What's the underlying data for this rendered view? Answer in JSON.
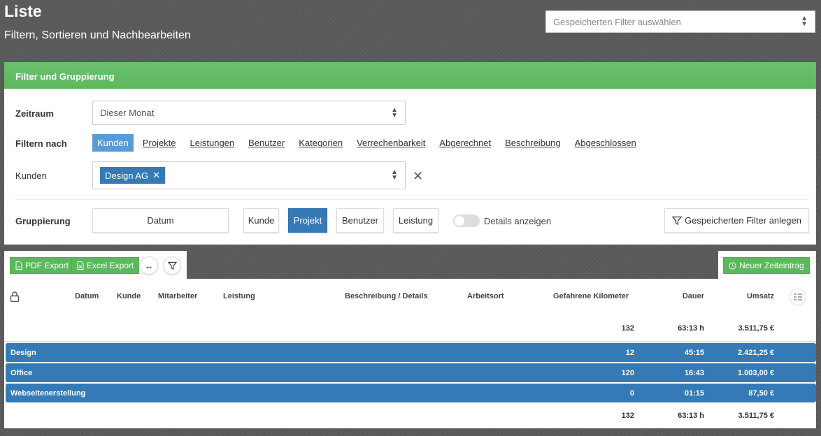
{
  "header": {
    "title": "Liste",
    "subtitle": "Filtern, Sortieren und Nachbearbeiten",
    "saved_filter_placeholder": "Gespeicherten Filter auswählen"
  },
  "filter_panel": {
    "title": "Filter und Gruppierung",
    "zeitraum_label": "Zeitraum",
    "zeitraum_value": "Dieser Monat",
    "filtern_nach_label": "Filtern nach",
    "filter_options": [
      "Kunden",
      "Projekte",
      "Leistungen",
      "Benutzer",
      "Kategorien",
      "Verrechenbarkeit",
      "Abgerechnet",
      "Beschreibung",
      "Abgeschlossen"
    ],
    "active_filter": "Kunden",
    "kunden_label": "Kunden",
    "kunden_tag": "Design AG",
    "gruppierung_label": "Gruppierung",
    "group_options": {
      "datum": "Datum",
      "kunde": "Kunde",
      "projekt": "Projekt",
      "benutzer": "Benutzer",
      "leistung": "Leistung"
    },
    "active_group": "Projekt",
    "details_toggle_label": "Details anzeigen",
    "details_enabled": false,
    "save_filter_label": "Gespeicherten Filter anlegen"
  },
  "toolbar": {
    "pdf_export": "PDF Export",
    "excel_export": "Excel Export",
    "new_entry": "Neuer Zeiteintrag"
  },
  "table": {
    "columns": {
      "datum": "Datum",
      "kunde": "Kunde",
      "mitarbeiter": "Mitarbeiter",
      "leistung": "Leistung",
      "beschreibung": "Beschreibung / Details",
      "arbeitsort": "Arbeitsort",
      "kilometer": "Gefahrene Kilometer",
      "dauer": "Dauer",
      "umsatz": "Umsatz"
    },
    "top_total": {
      "kilometer": "132",
      "dauer": "63:13 h",
      "umsatz": "3.511,75 €"
    },
    "groups": [
      {
        "name": "Design",
        "kilometer": "12",
        "dauer": "45:15",
        "umsatz": "2.421,25 €"
      },
      {
        "name": "Office",
        "kilometer": "120",
        "dauer": "16:43",
        "umsatz": "1.003,00 €"
      },
      {
        "name": "Webseitenerstellung",
        "kilometer": "0",
        "dauer": "01:15",
        "umsatz": "87,50 €"
      }
    ],
    "bottom_total": {
      "kilometer": "132",
      "dauer": "63:13 h",
      "umsatz": "3.511,75 €"
    }
  },
  "colors": {
    "accent_green": "#5cb85c",
    "accent_blue": "#337ab7",
    "active_link": "#5b9bd5"
  }
}
